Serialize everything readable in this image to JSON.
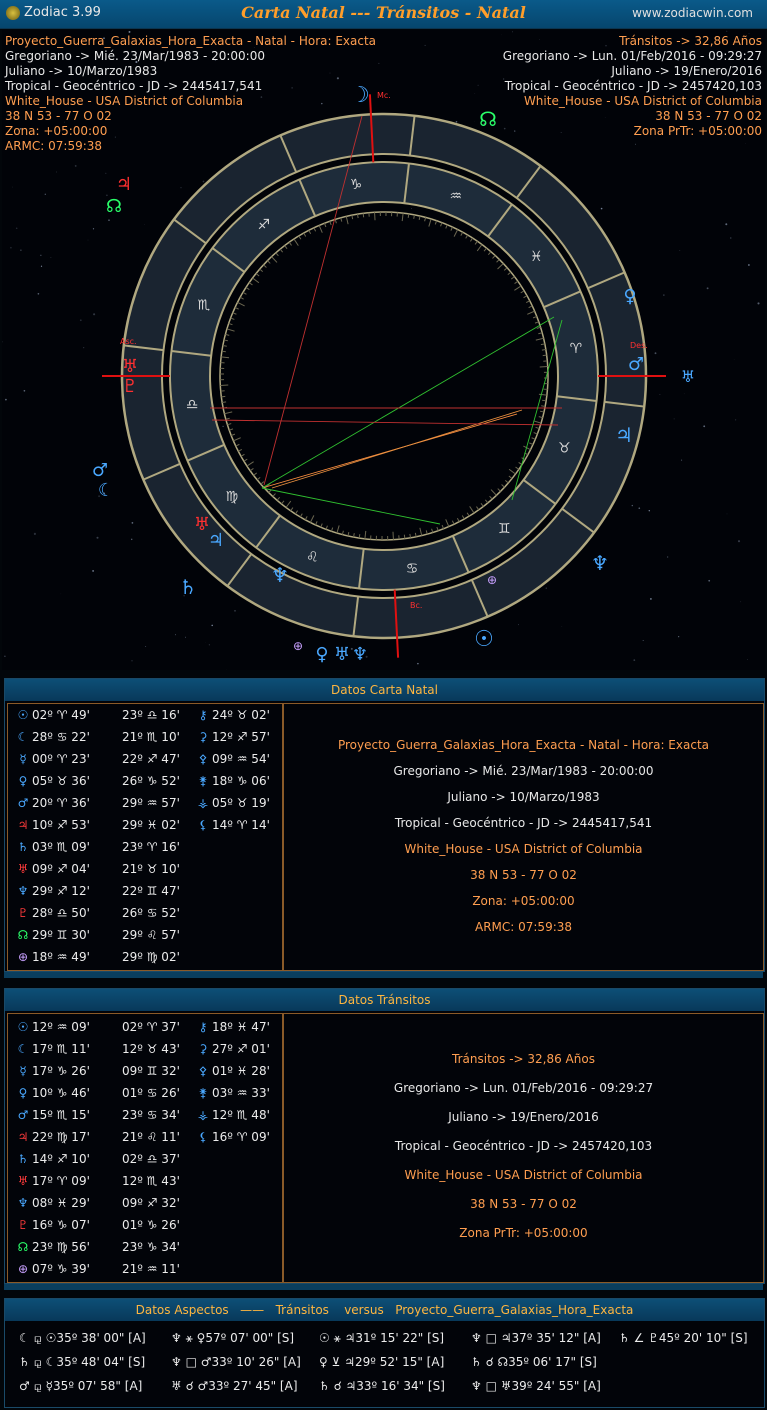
{
  "titlebar": {
    "app_name": "Zodiac 3.99",
    "title": "Carta Natal --- Tránsitos - Natal",
    "website": "www.zodiacwin.com"
  },
  "header_left": [
    "Proyecto_Guerra_Galaxias_Hora_Exacta - Natal - Hora: Exacta",
    "Gregoriano -> Mié. 23/Mar/1983 - 20:00:00",
    "Juliano -> 10/Marzo/1983",
    "Tropical - Geocéntrico - JD -> 2445417,541",
    "White_House - USA District of Columbia",
    "38 N 53 - 77 O 02",
    "Zona: +05:00:00",
    "ARMC: 07:59:38"
  ],
  "header_right": [
    "Tránsitos -> 32,86 Años",
    "Gregoriano -> Lun. 01/Feb/2016 - 09:29:27",
    "Juliano -> 19/Enero/2016",
    "Tropical - Geocéntrico - JD -> 2457420,103",
    "White_House - USA District of Columbia",
    "38 N 53 - 77 O 02",
    "Zona PrTr: +05:00:00"
  ],
  "wheel": {
    "axis_labels": {
      "asc": "Asc.",
      "des": "Des.",
      "mc": "Mc.",
      "bc": "Bc."
    },
    "sign_glyphs": [
      "♈",
      "♉",
      "♊",
      "♋",
      "♌",
      "♍",
      "♎",
      "♏",
      "♐",
      "♑",
      "♒",
      "♓"
    ],
    "colors": {
      "ring": "#b0a880",
      "sign_band": "#1c2a38",
      "axis": "#e01010"
    }
  },
  "natal_panel": {
    "title": "Datos Carta Natal",
    "col1": [
      {
        "g": "☉",
        "v": "02º ♈ 49'"
      },
      {
        "g": "☾",
        "v": "28º ♋ 22'"
      },
      {
        "g": "☿",
        "v": "00º ♈ 23'"
      },
      {
        "g": "♀",
        "v": "05º ♉ 36'"
      },
      {
        "g": "♂",
        "v": "20º ♈ 36'"
      },
      {
        "g": "♃",
        "v": "10º ♐ 53'"
      },
      {
        "g": "♄",
        "v": "03º ♏ 09'"
      },
      {
        "g": "♅",
        "v": "09º ♐ 04'"
      },
      {
        "g": "♆",
        "v": "29º ♐ 12'"
      },
      {
        "g": "♇",
        "v": "28º ♎ 50'"
      },
      {
        "g": "☊",
        "v": "29º ♊ 30'"
      },
      {
        "g": "⊕",
        "v": "18º ♒ 49'"
      }
    ],
    "col2": [
      "23º ♎ 16'",
      "21º ♏ 10'",
      "22º ♐ 47'",
      "26º ♑ 52'",
      "29º ♒ 57'",
      "29º ♓ 02'",
      "23º ♈ 16'",
      "21º ♉ 10'",
      "22º ♊ 47'",
      "26º ♋ 52'",
      "29º ♌ 57'",
      "29º ♍ 02'"
    ],
    "col3": [
      {
        "g": "⚷",
        "v": "24º ♉ 02'"
      },
      {
        "g": "⚳",
        "v": "12º ♐ 57'"
      },
      {
        "g": "⚴",
        "v": "09º ♒ 54'"
      },
      {
        "g": "⚵",
        "v": "18º ♑ 06'"
      },
      {
        "g": "⚶",
        "v": "05º ♉ 19'"
      },
      {
        "g": "⚸",
        "v": "14º ♈ 14'"
      }
    ],
    "description": [
      "Proyecto_Guerra_Galaxias_Hora_Exacta - Natal - Hora: Exacta",
      "Gregoriano -> Mié. 23/Mar/1983 - 20:00:00",
      "Juliano -> 10/Marzo/1983",
      "Tropical - Geocéntrico - JD -> 2445417,541",
      "White_House - USA District of Columbia",
      "38 N 53 - 77 O 02",
      "Zona: +05:00:00",
      "ARMC: 07:59:38"
    ]
  },
  "transit_panel": {
    "title": "Datos Tránsitos",
    "col1": [
      {
        "g": "☉",
        "v": "12º ♒ 09'"
      },
      {
        "g": "☾",
        "v": "17º ♏ 11'"
      },
      {
        "g": "☿",
        "v": "17º ♑ 26'"
      },
      {
        "g": "♀",
        "v": "10º ♑ 46'"
      },
      {
        "g": "♂",
        "v": "15º ♏ 15'"
      },
      {
        "g": "♃",
        "v": "22º ♍ 17'"
      },
      {
        "g": "♄",
        "v": "14º ♐ 10'"
      },
      {
        "g": "♅",
        "v": "17º ♈ 09'"
      },
      {
        "g": "♆",
        "v": "08º ♓ 29'"
      },
      {
        "g": "♇",
        "v": "16º ♑ 07'"
      },
      {
        "g": "☊",
        "v": "23º ♍ 56'"
      },
      {
        "g": "⊕",
        "v": "07º ♑ 39'"
      }
    ],
    "col2": [
      "02º ♈ 37'",
      "12º ♉ 43'",
      "09º ♊ 32'",
      "01º ♋ 26'",
      "23º ♋ 34'",
      "21º ♌ 11'",
      "02º ♎ 37'",
      "12º ♏ 43'",
      "09º ♐ 32'",
      "01º ♑ 26'",
      "23º ♑ 34'",
      "21º ♒ 11'"
    ],
    "col2_g": [
      "♊",
      "♊",
      "♊",
      "♊",
      "♊",
      "♊",
      "♍",
      "♍",
      "♍",
      "♍",
      "♊",
      "♊"
    ],
    "col3": [
      {
        "g": "⚷",
        "v": "18º ♓ 47'"
      },
      {
        "g": "⚳",
        "v": "27º ♐ 01'"
      },
      {
        "g": "⚴",
        "v": "01º ♓ 28'"
      },
      {
        "g": "⚵",
        "v": "03º ♒ 33'"
      },
      {
        "g": "⚶",
        "v": "12º ♏ 48'"
      },
      {
        "g": "⚸",
        "v": "16º ♈ 09'"
      }
    ],
    "description": [
      "Tránsitos -> 32,86 Años",
      "Gregoriano -> Lun. 01/Feb/2016 - 09:29:27",
      "Juliano -> 19/Enero/2016",
      "Tropical - Geocéntrico - JD -> 2457420,103",
      "White_House - USA District of Columbia",
      "38 N 53 - 77 O 02",
      "Zona PrTr: +05:00:00"
    ]
  },
  "aspects_panel": {
    "title_left": "Datos Aspectos",
    "title_dash": "——",
    "title_mid": "Tránsitos    versus",
    "title_right": "Proyecto_Guerra_Galaxias_Hora_Exacta",
    "rows": [
      [
        "☾ ⚼ ☉35º 38' 00\" [A]",
        "♆ ⚹ ♀57º 07' 00\" [S]",
        "☉ ⚹ ♃31º 15' 22\" [S]",
        "♆ □ ♃37º 35' 12\" [A]",
        "♄ ∠ ♇45º 20' 10\" [S]"
      ],
      [
        "♄ ⚼ ☾35º 48' 04\" [S]",
        "♆ □ ♂33º 10' 26\" [A]",
        "♀ ⊻ ♃29º 52' 15\" [A]",
        "♄ ☌ ☊35º 06' 17\" [S]",
        ""
      ],
      [
        "♂ ⚼ ☿35º 07' 58\" [A]",
        "♅ ☌ ♂33º 27' 45\" [A]",
        "♄ ☌ ♃33º 16' 34\" [S]",
        "♆ □ ♅39º 24' 55\" [A]",
        ""
      ]
    ]
  }
}
